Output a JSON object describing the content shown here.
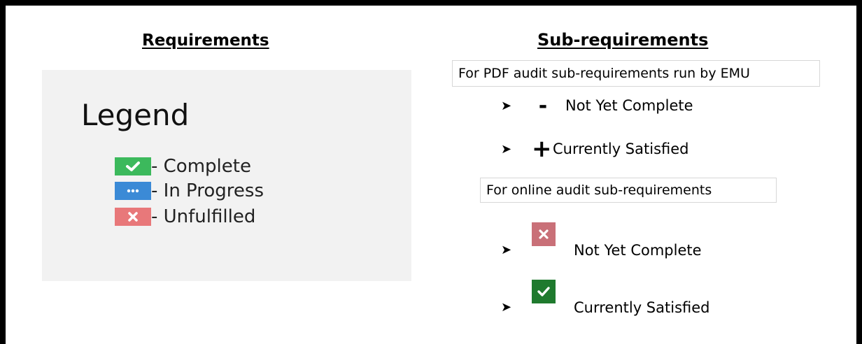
{
  "requirements": {
    "heading": "Requirements",
    "legend": {
      "title": "Legend",
      "items": [
        {
          "label": "- Complete",
          "color": "#3cb95c",
          "icon": "check-icon"
        },
        {
          "label": "- In Progress",
          "color": "#3b8ad6",
          "icon": "ellipsis-icon"
        },
        {
          "label": "- Unfulfilled",
          "color": "#e8787a",
          "icon": "x-icon"
        }
      ]
    }
  },
  "sub_requirements": {
    "heading": "Sub-requirements",
    "pdf_note": "For PDF audit sub-requirements run by EMU",
    "pdf_items": [
      {
        "symbol": "-",
        "label": "Not Yet Complete"
      },
      {
        "symbol": "+",
        "label": "Currently Satisfied"
      }
    ],
    "online_note": "For online audit sub-requirements",
    "online_items": [
      {
        "label": "Not Yet Complete",
        "color": "#c97078",
        "icon": "x-icon"
      },
      {
        "label": "Currently Satisfied",
        "color": "#1f7a2e",
        "icon": "check-icon"
      }
    ],
    "bullet_icon": "arrow-bullet-icon"
  }
}
